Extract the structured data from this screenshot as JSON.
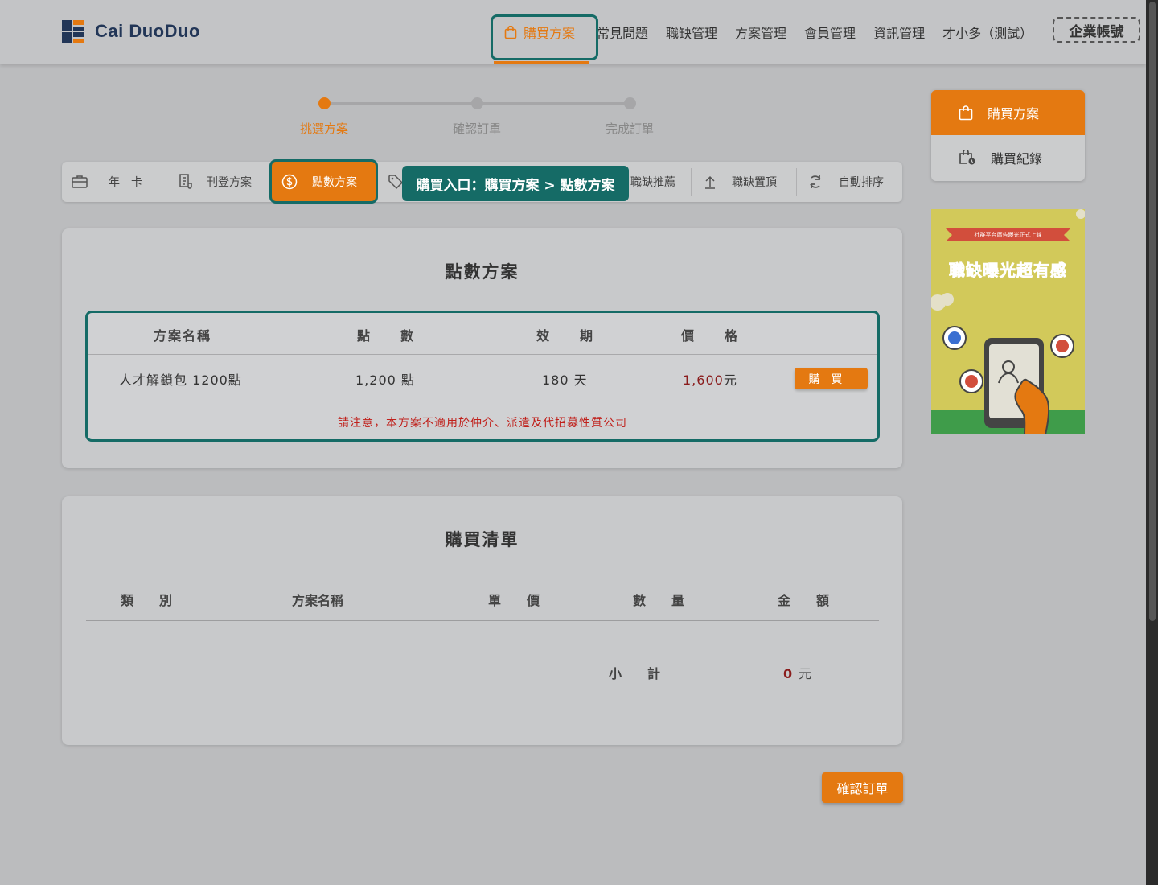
{
  "header": {
    "brand": "Cai DuoDuo",
    "nav": [
      {
        "label": "購買方案",
        "active": true
      },
      {
        "label": "常見問題"
      },
      {
        "label": "職缺管理"
      },
      {
        "label": "方案管理"
      },
      {
        "label": "會員管理"
      },
      {
        "label": "資訊管理"
      },
      {
        "label": "才小多（測試）"
      }
    ],
    "account_button": "企業帳號"
  },
  "stepper": [
    "挑選方案",
    "確認訂單",
    "完成訂單"
  ],
  "tabs": [
    "年　卡",
    "刊登方案",
    "點數方案",
    "",
    "職缺推薦",
    "職缺置頂",
    "自動排序"
  ],
  "tooltip": "購買入口：購買方案 > 點數方案",
  "points_plan": {
    "title": "點數方案",
    "columns": [
      "方案名稱",
      "點　　數",
      "效　　期",
      "價　　格"
    ],
    "row": {
      "name": "人才解鎖包 1200點",
      "points": "1,200 點",
      "period": "180 天",
      "price": "1,600",
      "price_unit": "元",
      "buy": "購買"
    },
    "notice": "請注意，本方案不適用於仲介、派遣及代招募性質公司"
  },
  "purchase_list": {
    "title": "購買清單",
    "columns": [
      "類　　別",
      "方案名稱",
      "單　　價",
      "數　　量",
      "金　　額"
    ],
    "subtotal_label": "小　　計",
    "subtotal_value": "0",
    "subtotal_unit": "元"
  },
  "confirm_button": "確認訂單",
  "side_menu": [
    {
      "label": "購買方案",
      "active": true
    },
    {
      "label": "購買紀錄"
    }
  ],
  "banner": {
    "ribbon": "社群平台廣告曝光正式上線",
    "headline": "職缺曝光超有感"
  },
  "colors": {
    "accent": "#e47911",
    "highlight": "#156b66",
    "price": "#8a1c1c",
    "notice": "#c0201b"
  }
}
